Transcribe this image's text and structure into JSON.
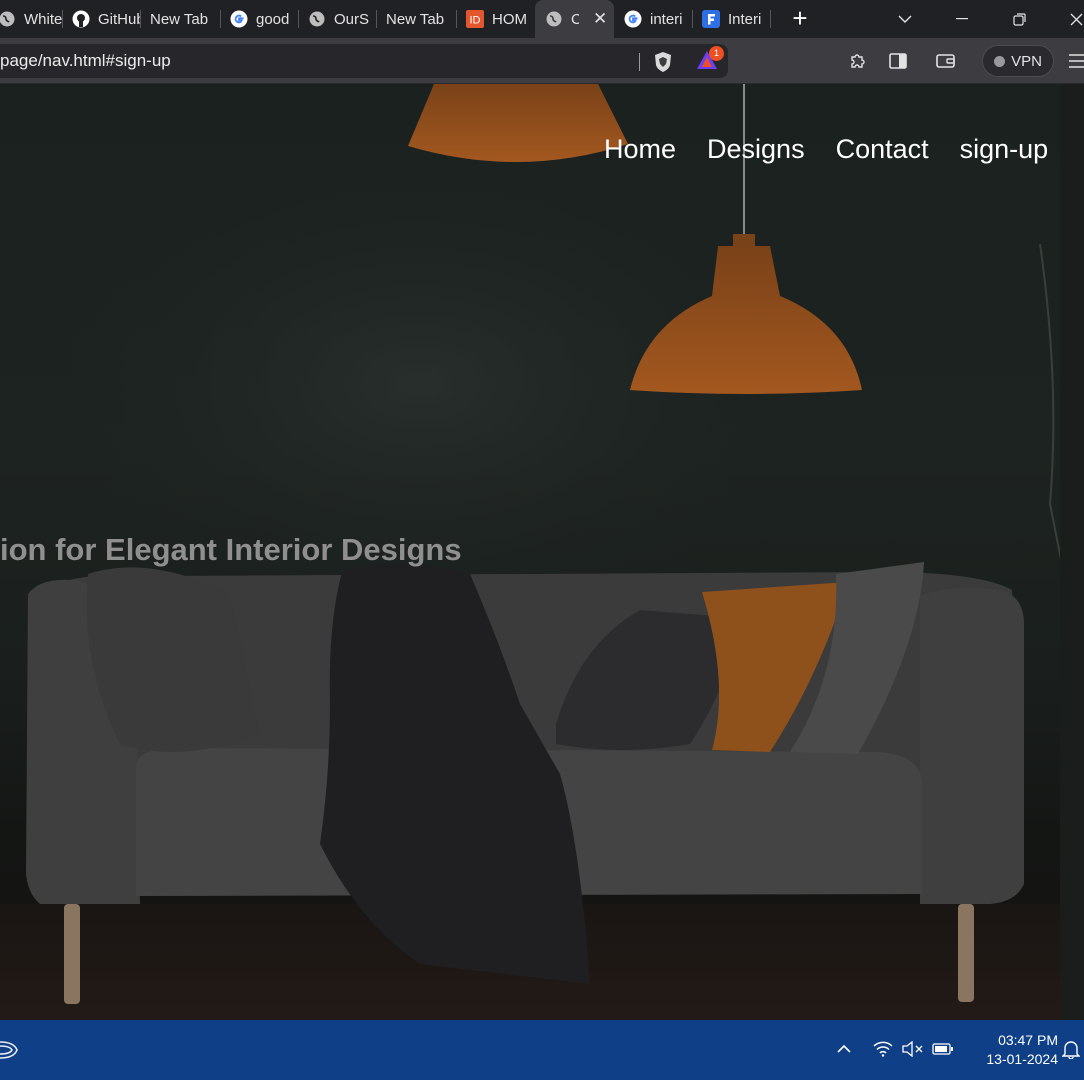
{
  "browser": {
    "tabs": [
      {
        "title": "White",
        "icon": "globe-icon"
      },
      {
        "title": "GitHub",
        "icon": "github-icon"
      },
      {
        "title": "New Tab",
        "icon": ""
      },
      {
        "title": "good",
        "icon": "google-icon"
      },
      {
        "title": "OurS",
        "icon": "globe-icon"
      },
      {
        "title": "New Tab",
        "icon": ""
      },
      {
        "title": "HOM",
        "icon": "id-logo-icon"
      },
      {
        "title": "C",
        "icon": "globe-icon",
        "active": true
      },
      {
        "title": "interi",
        "icon": "google-icon"
      },
      {
        "title": "Interi",
        "icon": "f-logo-icon"
      }
    ],
    "url": "page/nav.html#sign-up",
    "rewards_badge": "1",
    "vpn_label": "VPN"
  },
  "page": {
    "nav": [
      "Home",
      "Designs",
      "Contact",
      "sign-up"
    ],
    "hero_text": "ion for Elegant Interior Designs"
  },
  "taskbar": {
    "time": "03:47 PM",
    "date": "13-01-2024"
  },
  "colors": {
    "tabstrip": "#202124",
    "toolbar": "#3c3c41",
    "taskbar": "#0f3f86",
    "lamp": "#8a4a1c",
    "sofa": "#3a3a3a",
    "orange_pillow": "#9a5a1e"
  }
}
